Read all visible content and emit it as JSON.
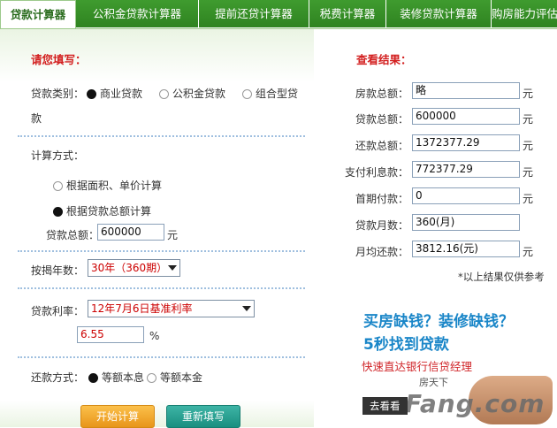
{
  "tabs": [
    {
      "label": "贷款计算器",
      "active": true
    },
    {
      "label": "公积金贷款计算器",
      "active": false
    },
    {
      "label": "提前还贷计算器",
      "active": false
    },
    {
      "label": "税费计算器",
      "active": false
    },
    {
      "label": "装修贷款计算器",
      "active": false
    },
    {
      "label": "购房能力评估",
      "active": false
    }
  ],
  "form": {
    "title": "请您填写：",
    "loan_type_label": "贷款类别：",
    "loan_type_options": [
      "商业贷款",
      "公积金贷款",
      "组合型贷",
      "款"
    ],
    "loan_type_selected": "商业贷款",
    "calc_method_label": "计算方式：",
    "calc_method_options": [
      "根据面积、单价计算",
      "根据贷款总额计算"
    ],
    "calc_method_selected": "根据贷款总额计算",
    "loan_total_label": "贷款总额：",
    "loan_total_value": "600000",
    "loan_total_unit": "元",
    "years_label": "按揭年数：",
    "years_value": "30年（360期）",
    "rate_label": "贷款利率：",
    "rate_value": "12年7月6日基准利率",
    "rate_percent_value": "6.55",
    "rate_percent_unit": "%",
    "repay_label": "还款方式：",
    "repay_options": [
      "等额本息",
      "等额本金"
    ],
    "repay_selected": "等额本息",
    "calc_button": "开始计算",
    "reset_button": "重新填写"
  },
  "results": {
    "title": "查看结果：",
    "rows": [
      {
        "label": "房款总额：",
        "value": "略",
        "unit": "元"
      },
      {
        "label": "贷款总额：",
        "value": "600000",
        "unit": "元"
      },
      {
        "label": "还款总额：",
        "value": "1372377.29",
        "unit": "元"
      },
      {
        "label": "支付利息款：",
        "value": "772377.29",
        "unit": "元"
      },
      {
        "label": "首期付款：",
        "value": "0",
        "unit": "元"
      },
      {
        "label": "贷款月数：",
        "value": "360(月)",
        "unit": ""
      },
      {
        "label": "月均还款：",
        "value": "3812.16(元)",
        "unit": "元"
      }
    ],
    "note": "*以上结果仅供参考"
  },
  "ad": {
    "line1": "买房缺钱？装修缺钱？",
    "line2": "5秒找到贷款",
    "line3": "快速直达银行信贷经理",
    "button": "去看看",
    "logo_top": "房天下",
    "logo": "Fang.com"
  },
  "colors": {
    "tab_green": "#2f8320",
    "title_red": "#d32020",
    "ad_blue": "#1a86c8"
  }
}
